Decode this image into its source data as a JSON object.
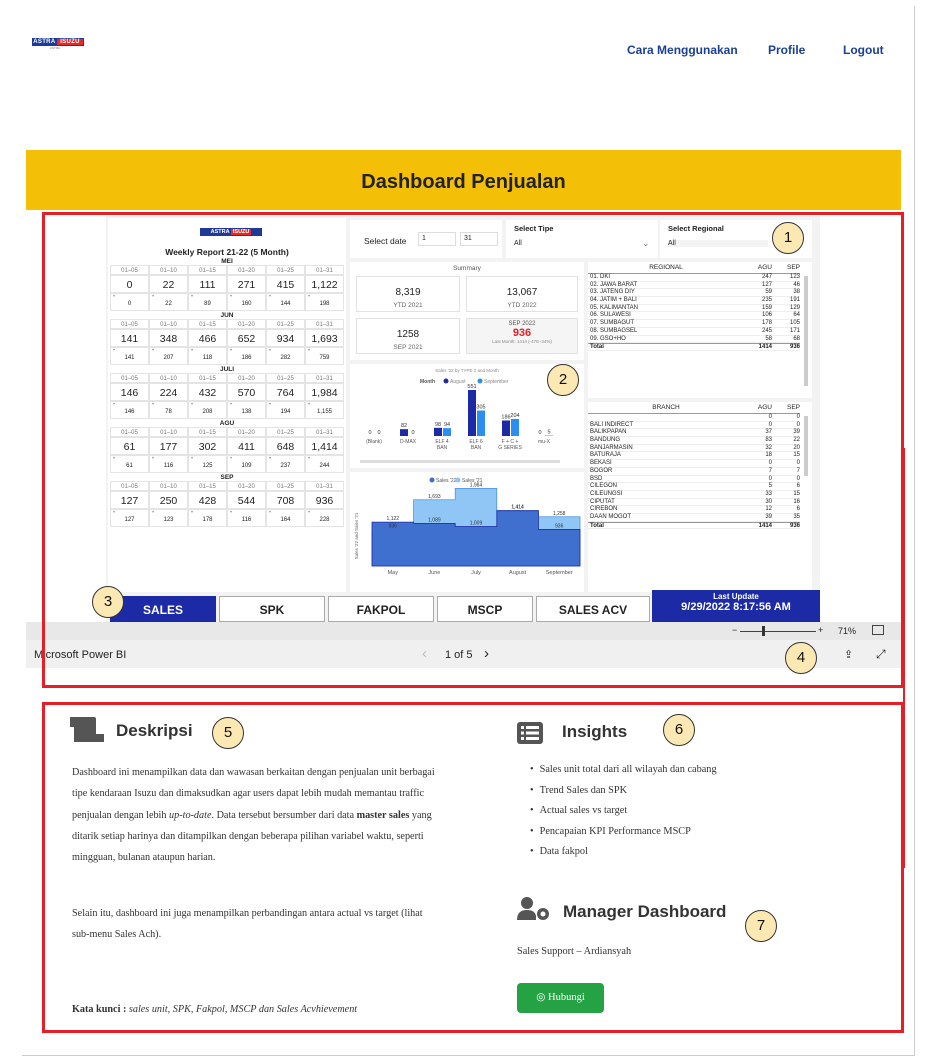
{
  "header": {
    "logo_text_a": "ASTRA",
    "logo_text_b": "ISUZU",
    "logo_sub": "ASTRA",
    "nav": [
      "Cara Menggunakan",
      "Profile",
      "Logout"
    ]
  },
  "banner": {
    "title": "Dashboard Penjualan"
  },
  "markers": [
    "1",
    "2",
    "3",
    "4",
    "5",
    "6",
    "7"
  ],
  "colors": {
    "accent": "#f3c007",
    "brand": "#1b3f92",
    "highlight": "#e41f26",
    "tab_active": "#1c2aa6",
    "button": "#25a244"
  },
  "weekly": {
    "title": "Weekly Report 21-22 (5 Month)",
    "months": [
      {
        "name": "MEI",
        "headers": [
          "01–05",
          "01–10",
          "01–15",
          "01–20",
          "01–25",
          "01–31"
        ],
        "values": [
          "0",
          "22",
          "111",
          "271",
          "415",
          "1,122"
        ],
        "subs": [
          "0",
          "22",
          "89",
          "160",
          "144",
          "198"
        ]
      },
      {
        "name": "JUN",
        "headers": [
          "01–05",
          "01–10",
          "01–15",
          "01–20",
          "01–25",
          "01–31"
        ],
        "values": [
          "141",
          "348",
          "466",
          "652",
          "934",
          "1,693"
        ],
        "subs": [
          "141",
          "207",
          "118",
          "186",
          "282",
          "759"
        ]
      },
      {
        "name": "JULI",
        "headers": [
          "01–05",
          "01–10",
          "01–15",
          "01–20",
          "01–25",
          "01–31"
        ],
        "values": [
          "146",
          "224",
          "432",
          "570",
          "764",
          "1,984"
        ],
        "subs": [
          "146",
          "78",
          "208",
          "138",
          "194",
          "1,155"
        ]
      },
      {
        "name": "AGU",
        "headers": [
          "01–05",
          "01–10",
          "01–15",
          "01–20",
          "01–25",
          "01–31"
        ],
        "values": [
          "61",
          "177",
          "302",
          "411",
          "648",
          "1,414"
        ],
        "subs": [
          "61",
          "116",
          "125",
          "109",
          "237",
          "244"
        ]
      },
      {
        "name": "SEP",
        "headers": [
          "01–05",
          "01–10",
          "01–15",
          "01–20",
          "01–25",
          "01–31"
        ],
        "values": [
          "127",
          "250",
          "428",
          "544",
          "708",
          "936"
        ],
        "subs": [
          "127",
          "123",
          "178",
          "116",
          "164",
          "228"
        ]
      }
    ]
  },
  "filters": {
    "select_date_label": "Select date",
    "date_from": "1",
    "date_to": "31",
    "tipe_label": "Select Tipe",
    "tipe_value": "All",
    "regional_label": "Select Regional",
    "regional_value": "All"
  },
  "summary": {
    "title": "Summary",
    "ytd2021": "8,319",
    "ytd2021_label": "YTD 2021",
    "ytd2022": "13,067",
    "ytd2022_label": "YTD 2022",
    "sep2021": "1258",
    "sep2021_label": "SEP 2021",
    "sep2022_title": "SEP 2022",
    "sep2022": "936",
    "sep2022_note": "Last Month: 1414 (-478 -34%)"
  },
  "chart_data": [
    {
      "type": "bar",
      "title": "Sales '22 by TYPE 2 and Month",
      "legend_title": "Month",
      "legend_position": "top",
      "categories": [
        "(Blank)",
        "D-MAX",
        "ELF 4 BAN",
        "ELF 6 BAN",
        "F + C + G SERIES",
        "mu-X"
      ],
      "series": [
        {
          "name": "August",
          "color": "#1c2aa6",
          "values": [
            0,
            82,
            98,
            551,
            186,
            0
          ]
        },
        {
          "name": "September",
          "color": "#2b8ef0",
          "values": [
            0,
            0,
            94,
            305,
            204,
            5
          ]
        }
      ]
    },
    {
      "type": "area",
      "ylabel": "Sales '22 and Sales '21",
      "legend_position": "top",
      "categories": [
        "May",
        "June",
        "July",
        "August",
        "September"
      ],
      "series": [
        {
          "name": "Sales '22",
          "color": "#3f6fcf",
          "values": [
            1122,
            1089,
            1009,
            1414,
            936
          ]
        },
        {
          "name": "Sales '21",
          "color": "#8fc6f5",
          "values": [
            936,
            1693,
            1984,
            1414,
            1258
          ]
        }
      ]
    }
  ],
  "regional": {
    "headers": [
      "REGIONAL",
      "AGU",
      "SEP"
    ],
    "rows": [
      [
        "01. DKI",
        "247",
        "123"
      ],
      [
        "02. JAWA BARAT",
        "127",
        "46"
      ],
      [
        "03. JATENG DIY",
        "59",
        "38"
      ],
      [
        "04. JATIM + BALI",
        "235",
        "191"
      ],
      [
        "05. KALIMANTAN",
        "159",
        "129"
      ],
      [
        "06. SULAWESI",
        "106",
        "64"
      ],
      [
        "07. SUMBAGUT",
        "178",
        "105"
      ],
      [
        "08. SUMBAGSEL",
        "245",
        "171"
      ],
      [
        "09. GSO+HO",
        "58",
        "68"
      ]
    ],
    "total": [
      "Total",
      "1414",
      "936"
    ]
  },
  "branch": {
    "headers": [
      "BRANCH",
      "AGU",
      "SEP"
    ],
    "rows": [
      [
        "",
        "0",
        "0"
      ],
      [
        "BALI INDIRECT",
        "0",
        "0"
      ],
      [
        "BALIKPAPAN",
        "37",
        "39"
      ],
      [
        "BANDUNG",
        "83",
        "22"
      ],
      [
        "BANJARMASIN",
        "32",
        "20"
      ],
      [
        "BATURAJA",
        "18",
        "15"
      ],
      [
        "BEKASI",
        "0",
        "0"
      ],
      [
        "BOGOR",
        "7",
        "7"
      ],
      [
        "BSD",
        "0",
        "0"
      ],
      [
        "CILEGON",
        "5",
        "6"
      ],
      [
        "CILEUNGSI",
        "33",
        "15"
      ],
      [
        "CIPUTAT",
        "30",
        "16"
      ],
      [
        "CIREBON",
        "12",
        "6"
      ],
      [
        "DAAN MOGOT",
        "39",
        "35"
      ]
    ],
    "total": [
      "Total",
      "1414",
      "936"
    ]
  },
  "tabs": [
    "SALES",
    "SPK",
    "FAKPOL",
    "MSCP",
    "SALES ACV"
  ],
  "last_update": {
    "label": "Last Update",
    "value": "9/29/2022 8:17:56 AM"
  },
  "powerbi": {
    "brand": "Microsoft Power BI",
    "pager": "1 of 5",
    "zoom": "71%"
  },
  "deskripsi": {
    "title": "Deskripsi",
    "p1a": "Dashboard ini menampilkan data dan wawasan berkaitan dengan penjualan unit berbagai tipe kendaraan Isuzu dan dimaksudkan agar users dapat lebih mudah memantau traffic penjualan dengan lebih ",
    "p1b": "up-to-date",
    "p1c": ". Data tersebut bersumber dari data ",
    "p1d": "master sales",
    "p1e": " yang ditarik setiap harinya dan ditampilkan dengan beberapa pilihan variabel waktu, seperti mingguan, bulanan ataupun harian.",
    "p2": "Selain itu, dashboard ini juga menampilkan perbandingan antara actual vs target (lihat sub-menu Sales Ach).",
    "kw_label": "Kata kunci :",
    "kw_value": " sales unit, SPK, Fakpol, MSCP dan Sales Acvhievement"
  },
  "insights": {
    "title": "Insights",
    "items": [
      "Sales unit total dari all wilayah dan cabang",
      "Trend Sales dan SPK",
      "Actual sales vs target",
      "Pencapaian KPI Performance MSCP",
      "Data fakpol"
    ]
  },
  "manager": {
    "title": "Manager Dashboard",
    "name": "Sales Support – Ardiansyah",
    "button": "Hubungi"
  }
}
